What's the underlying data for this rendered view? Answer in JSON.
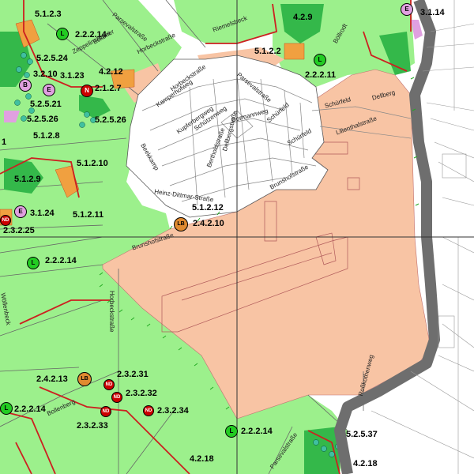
{
  "colors": {
    "green_zone": "#9cf08c",
    "dark_green": "#34b84a",
    "airport": "#f8c4a4",
    "settlement": "#ffffff",
    "river_gray": "#6e6e6e",
    "symbol_red": "#cc0000",
    "symbol_green": "#22cc22",
    "symbol_pink": "#e0a0e0",
    "symbol_orange": "#e08a30"
  },
  "zone_labels": [
    "5.1.2.3",
    "2.2.2.14",
    "4.2.9",
    "3.1.14",
    "5.1.2.2",
    "2.2.2.11",
    "5.2.5.24",
    "3.2.10",
    "3.1.23",
    "4.2.12",
    "2.1.2.7",
    "5.2.5.21",
    "5.2.5.26",
    "5.2.5.26",
    "5.1.2.8",
    "5.1.2.10",
    "5.1.2.9",
    "3.1.24",
    "5.1.2.11",
    "5.1.2.12",
    "2.4.2.10",
    "2.3.2.25",
    "2.2.2.14",
    "2.4.2.13",
    "2.3.2.31",
    "2.3.2.32",
    "2.2.2.14",
    "2.3.2.34",
    "2.3.2.33",
    "2.2.2.14",
    "5.2.5.37",
    "4.2.18",
    "4.2.18",
    "1"
  ],
  "streets": [
    "Parsevalstraße",
    "Eckener",
    "Horbeckstraße",
    "Riemelsbeck",
    "Zeppelinstraße",
    "Parsevalstraße",
    "Kamperhofweg",
    "Böllrodt",
    "Kupferbergweg",
    "Schützenweg",
    "Dormannweg",
    "Lilienthalstraße",
    "Schürfeld",
    "Dellberg",
    "Beekkamp",
    "Bertholdstraße",
    "Dellbergstraße",
    "Schürfeld",
    "Brunshofstraße",
    "Heinz-Dittmar-Straße",
    "Brunshofstraße",
    "Horbeckstraße",
    "Wöllenbeck",
    "Roßkothenweg",
    "Bollenberg",
    "Parsevalstraße",
    "Schürfeld",
    "Horbeckstraße"
  ],
  "symbols": [
    {
      "code": "L"
    },
    {
      "code": "L"
    },
    {
      "code": "E"
    },
    {
      "code": "B"
    },
    {
      "code": "E"
    },
    {
      "code": "N"
    },
    {
      "code": "E"
    },
    {
      "code": "ND"
    },
    {
      "code": "LB"
    },
    {
      "code": "L"
    },
    {
      "code": "LB"
    },
    {
      "code": "ND"
    },
    {
      "code": "ND"
    },
    {
      "code": "ND"
    },
    {
      "code": "ND"
    },
    {
      "code": "L"
    },
    {
      "code": "L"
    },
    {
      "code": "L"
    }
  ]
}
